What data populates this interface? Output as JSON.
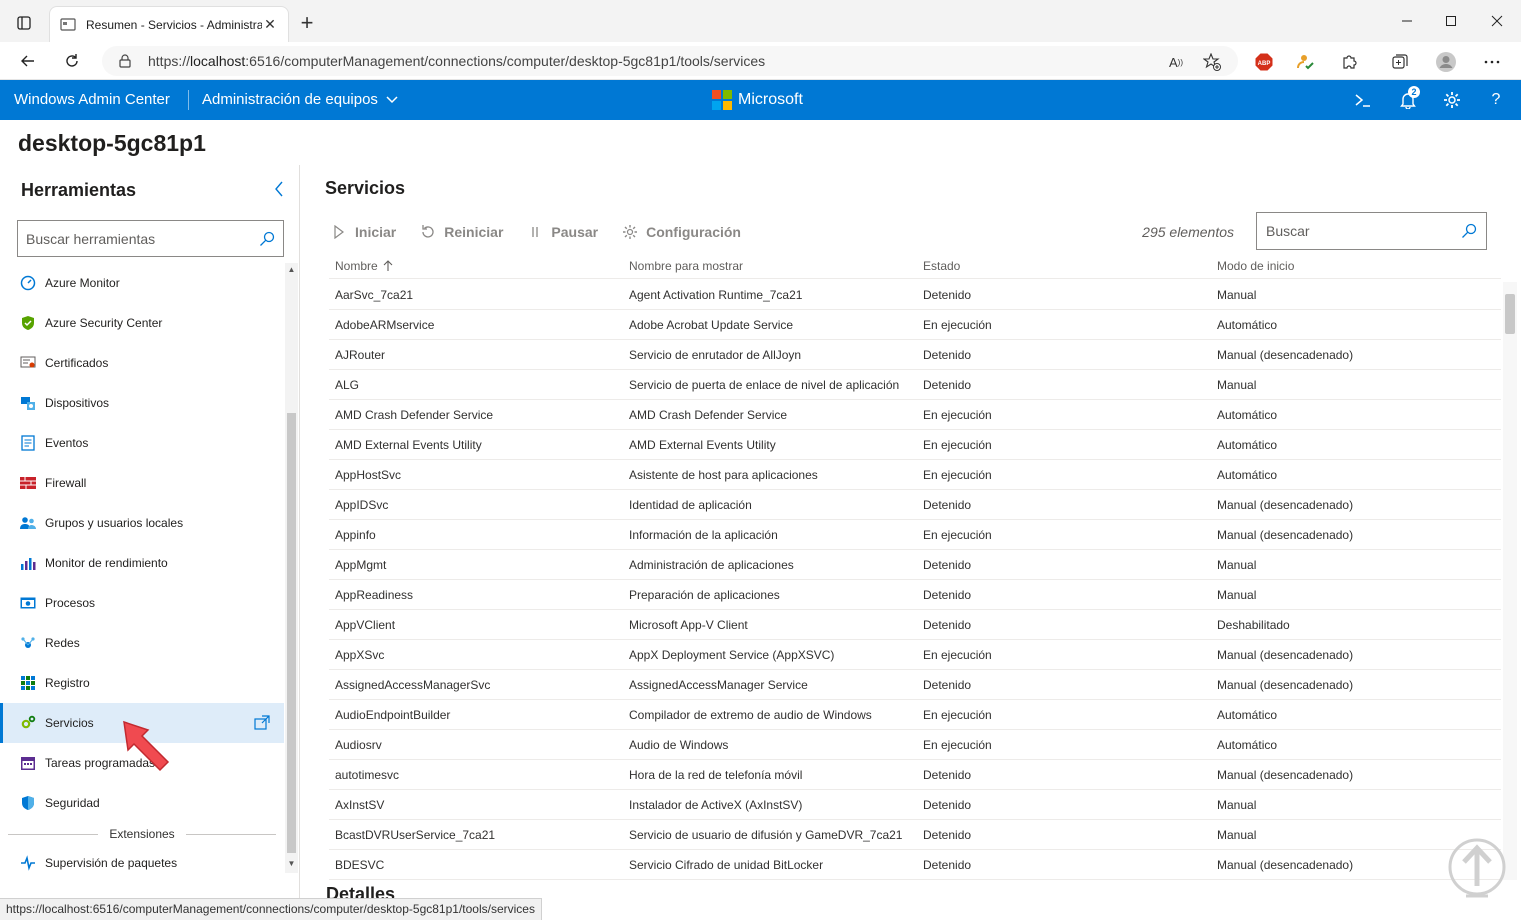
{
  "browser": {
    "tab_title": "Resumen - Servicios - Administra",
    "url_scheme": "https://",
    "url_host": "localhost",
    "url_rest": ":6516/computerManagement/connections/computer/desktop-5gc81p1/tools/services",
    "status_url": "https://localhost:6516/computerManagement/connections/computer/desktop-5gc81p1/tools/services"
  },
  "header": {
    "brand": "Windows Admin Center",
    "context": "Administración de equipos",
    "vendor": "Microsoft",
    "notifications_count": "2",
    "accent_color": "#0078d4"
  },
  "page": {
    "machine_name": "desktop-5gc81p1"
  },
  "sidebar": {
    "title": "Herramientas",
    "search_placeholder": "Buscar herramientas",
    "items": [
      {
        "label": "Azure Monitor",
        "icon": "azure-monitor-icon"
      },
      {
        "label": "Azure Security Center",
        "icon": "azure-security-icon"
      },
      {
        "label": "Certificados",
        "icon": "certificate-icon"
      },
      {
        "label": "Dispositivos",
        "icon": "devices-icon"
      },
      {
        "label": "Eventos",
        "icon": "events-icon"
      },
      {
        "label": "Firewall",
        "icon": "firewall-icon"
      },
      {
        "label": "Grupos y usuarios locales",
        "icon": "users-icon"
      },
      {
        "label": "Monitor de rendimiento",
        "icon": "performance-icon"
      },
      {
        "label": "Procesos",
        "icon": "processes-icon"
      },
      {
        "label": "Redes",
        "icon": "network-icon"
      },
      {
        "label": "Registro",
        "icon": "registry-icon"
      },
      {
        "label": "Servicios",
        "icon": "services-gear-icon"
      },
      {
        "label": "Tareas programadas",
        "icon": "scheduled-tasks-icon"
      },
      {
        "label": "Seguridad",
        "icon": "security-shield-icon"
      }
    ],
    "extensions_header": "Extensiones",
    "extension_items": [
      {
        "label": "Supervisión de paquetes",
        "icon": "package-monitor-icon"
      }
    ]
  },
  "main": {
    "title": "Servicios",
    "toolbar": {
      "start": "Iniciar",
      "restart": "Reiniciar",
      "pause": "Pausar",
      "settings": "Configuración"
    },
    "count": "295 elementos",
    "search_placeholder": "Buscar",
    "columns": [
      "Nombre",
      "Nombre para mostrar",
      "Estado",
      "Modo de inicio"
    ],
    "rows": [
      [
        "AarSvc_7ca21",
        "Agent Activation Runtime_7ca21",
        "Detenido",
        "Manual"
      ],
      [
        "AdobeARMservice",
        "Adobe Acrobat Update Service",
        "En ejecución",
        "Automático"
      ],
      [
        "AJRouter",
        "Servicio de enrutador de AllJoyn",
        "Detenido",
        "Manual (desencadenado)"
      ],
      [
        "ALG",
        "Servicio de puerta de enlace de nivel de aplicación",
        "Detenido",
        "Manual"
      ],
      [
        "AMD Crash Defender Service",
        "AMD Crash Defender Service",
        "En ejecución",
        "Automático"
      ],
      [
        "AMD External Events Utility",
        "AMD External Events Utility",
        "En ejecución",
        "Automático"
      ],
      [
        "AppHostSvc",
        "Asistente de host para aplicaciones",
        "En ejecución",
        "Automático"
      ],
      [
        "AppIDSvc",
        "Identidad de aplicación",
        "Detenido",
        "Manual (desencadenado)"
      ],
      [
        "Appinfo",
        "Información de la aplicación",
        "En ejecución",
        "Manual (desencadenado)"
      ],
      [
        "AppMgmt",
        "Administración de aplicaciones",
        "Detenido",
        "Manual"
      ],
      [
        "AppReadiness",
        "Preparación de aplicaciones",
        "Detenido",
        "Manual"
      ],
      [
        "AppVClient",
        "Microsoft App-V Client",
        "Detenido",
        "Deshabilitado"
      ],
      [
        "AppXSvc",
        "AppX Deployment Service (AppXSVC)",
        "En ejecución",
        "Manual (desencadenado)"
      ],
      [
        "AssignedAccessManagerSvc",
        "AssignedAccessManager Service",
        "Detenido",
        "Manual (desencadenado)"
      ],
      [
        "AudioEndpointBuilder",
        "Compilador de extremo de audio de Windows",
        "En ejecución",
        "Automático"
      ],
      [
        "Audiosrv",
        "Audio de Windows",
        "En ejecución",
        "Automático"
      ],
      [
        "autotimesvc",
        "Hora de la red de telefonía móvil",
        "Detenido",
        "Manual (desencadenado)"
      ],
      [
        "AxInstSV",
        "Instalador de ActiveX (AxInstSV)",
        "Detenido",
        "Manual"
      ],
      [
        "BcastDVRUserService_7ca21",
        "Servicio de usuario de difusión y GameDVR_7ca21",
        "Detenido",
        "Manual"
      ],
      [
        "BDESVC",
        "Servicio Cifrado de unidad BitLocker",
        "Detenido",
        "Manual (desencadenado)"
      ]
    ],
    "details_title": "Detalles"
  }
}
